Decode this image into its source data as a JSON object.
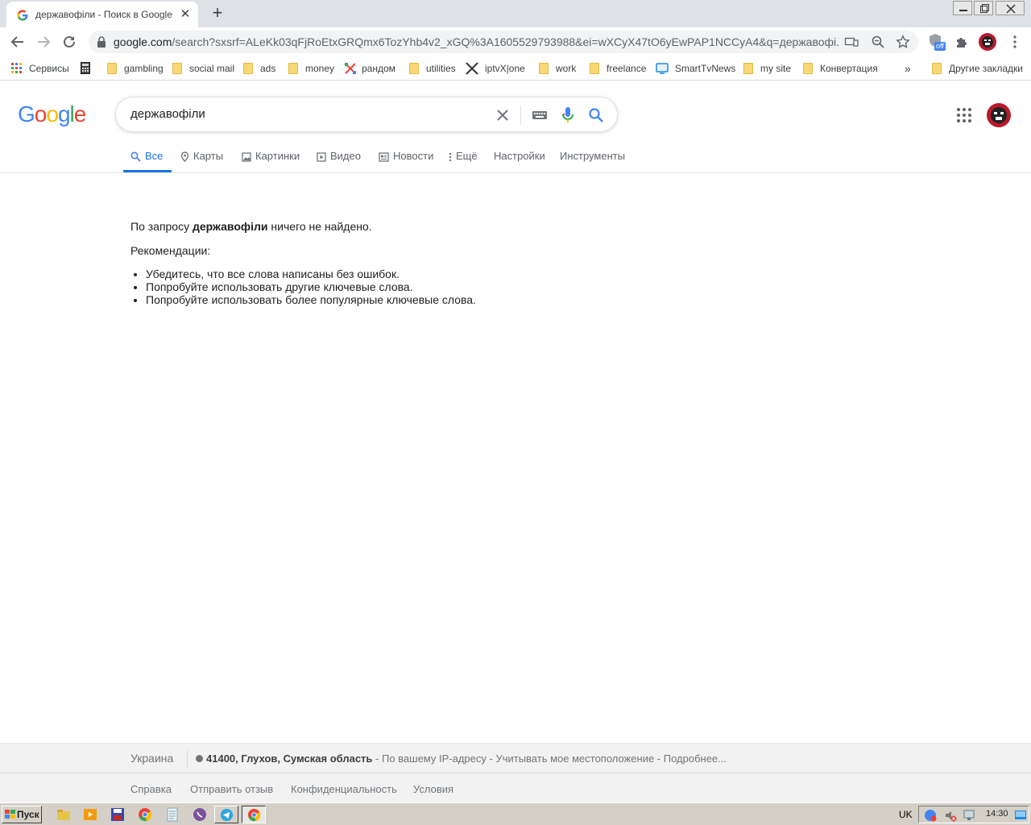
{
  "browser": {
    "tab": {
      "title": "державофіли - Поиск в Google"
    },
    "url": {
      "host": "google.com",
      "path": "/search?sxsrf=ALeKk03qFjRoEtxGRQmx6TozYhb4v2_xGQ%3A1605529793988&ei=wXCyX47tO6yEwPAP1NCCyA4&q=державофі..."
    },
    "extension_badge": "off",
    "bookmarks": [
      {
        "label": "Сервисы",
        "icon": "apps-grid-icon"
      },
      {
        "label": "",
        "icon": "calculator-icon"
      },
      {
        "label": "gambling",
        "icon": "folder-icon"
      },
      {
        "label": "social mail",
        "icon": "folder-icon"
      },
      {
        "label": "ads",
        "icon": "folder-icon"
      },
      {
        "label": "money",
        "icon": "folder-icon"
      },
      {
        "label": "рандом",
        "icon": "random-icon"
      },
      {
        "label": "utilities",
        "icon": "folder-icon"
      },
      {
        "label": "iptvX|one",
        "icon": "x-logo-icon"
      },
      {
        "label": "work",
        "icon": "folder-icon"
      },
      {
        "label": "freelance",
        "icon": "folder-icon"
      },
      {
        "label": "SmartTvNews",
        "icon": "tv-icon"
      },
      {
        "label": "my site",
        "icon": "folder-icon"
      },
      {
        "label": "Конвертация",
        "icon": "folder-icon"
      }
    ],
    "overflow_label": "»",
    "other_bookmarks": "Другие закладки"
  },
  "google": {
    "logo": "Google",
    "query": "державофіли",
    "tabs": [
      {
        "label": "Все",
        "icon": "search-icon",
        "active": true
      },
      {
        "label": "Карты",
        "icon": "map-pin-icon"
      },
      {
        "label": "Картинки",
        "icon": "image-icon"
      },
      {
        "label": "Видео",
        "icon": "video-icon"
      },
      {
        "label": "Новости",
        "icon": "news-icon"
      },
      {
        "label": "Ещё",
        "icon": "more-vert-icon"
      },
      {
        "label": "Настройки"
      },
      {
        "label": "Инструменты"
      }
    ],
    "results": {
      "no_result_prefix": "По запросу ",
      "no_result_query": "державофіли",
      "no_result_suffix": " ничего не найдено.",
      "recommendations_title": "Рекомендации:",
      "recommendations": [
        "Убедитесь, что все слова написаны без ошибок.",
        "Попробуйте использовать другие ключевые слова.",
        "Попробуйте использовать более популярные ключевые слова."
      ]
    },
    "footer": {
      "country": "Украина",
      "location_bold": "41400, Глухов, Сумская область",
      "location_rest": " - По вашему IP-адресу - Учитывать мое местоположение - Подробнее...",
      "links": [
        "Справка",
        "Отправить отзыв",
        "Конфиденциальность",
        "Условия"
      ]
    }
  },
  "taskbar": {
    "start_label": "Пуск",
    "language": "UK",
    "time": "14:30"
  },
  "colors": {
    "accent": "#1a73e8",
    "google_blue": "#4285f4",
    "google_red": "#ea4335",
    "google_yellow": "#fbbc05",
    "google_green": "#34a853"
  }
}
